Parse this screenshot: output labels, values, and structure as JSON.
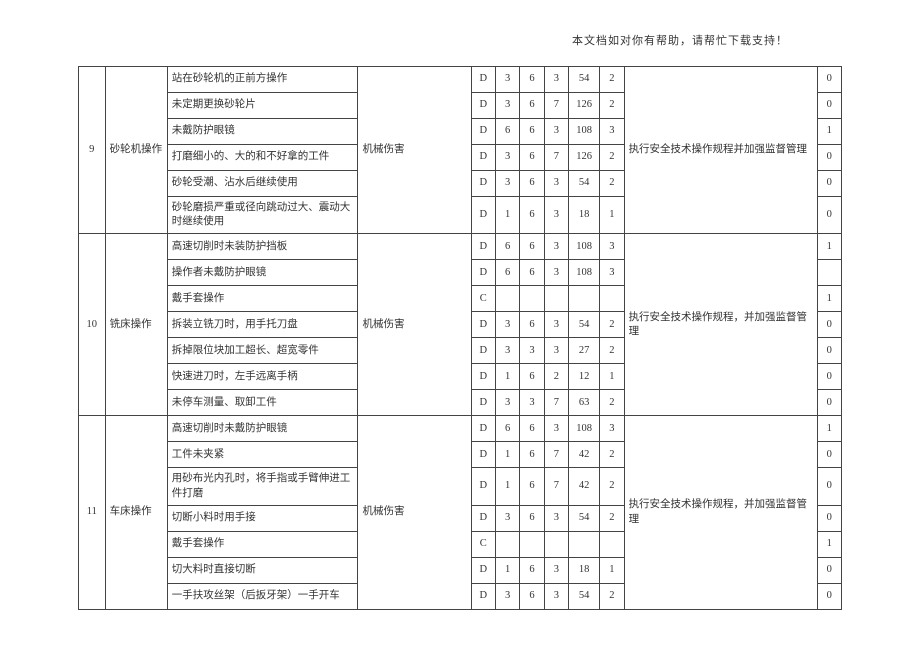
{
  "header_note": "本文档如对你有帮助，请帮忙下载支持！",
  "groups": [
    {
      "idx": "9",
      "op": "砂轮机操作",
      "hazard": "机械伤害",
      "measure": "执行安全技术操作规程并加强监督管理",
      "rows": [
        {
          "desc": "站在砂轮机的正前方操作",
          "d": "D",
          "v1": "3",
          "v2": "6",
          "v3": "3",
          "v4": "54",
          "v5": "2",
          "last": "0"
        },
        {
          "desc": "未定期更换砂轮片",
          "d": "D",
          "v1": "3",
          "v2": "6",
          "v3": "7",
          "v4": "126",
          "v5": "2",
          "last": "0"
        },
        {
          "desc": "未戴防护眼镜",
          "d": "D",
          "v1": "6",
          "v2": "6",
          "v3": "3",
          "v4": "108",
          "v5": "3",
          "last": "1"
        },
        {
          "desc": "打磨细小的、大的和不好拿的工件",
          "d": "D",
          "v1": "3",
          "v2": "6",
          "v3": "7",
          "v4": "126",
          "v5": "2",
          "last": "0"
        },
        {
          "desc": "砂轮受潮、沾水后继续使用",
          "d": "D",
          "v1": "3",
          "v2": "6",
          "v3": "3",
          "v4": "54",
          "v5": "2",
          "last": "0"
        },
        {
          "desc": "砂轮磨损严重或径向跳动过大、震动大时继续使用",
          "d": "D",
          "v1": "1",
          "v2": "6",
          "v3": "3",
          "v4": "18",
          "v5": "1",
          "last": "0"
        }
      ]
    },
    {
      "idx": "10",
      "op": "铣床操作",
      "hazard": "机械伤害",
      "measure": "执行安全技术操作规程，并加强监督管理",
      "rows": [
        {
          "desc": "高速切削时未装防护挡板",
          "d": "D",
          "v1": "6",
          "v2": "6",
          "v3": "3",
          "v4": "108",
          "v5": "3",
          "last": "1"
        },
        {
          "desc": "操作者未戴防护眼镜",
          "d": "D",
          "v1": "6",
          "v2": "6",
          "v3": "3",
          "v4": "108",
          "v5": "3",
          "last": ""
        },
        {
          "desc": "戴手套操作",
          "d": "C",
          "v1": "",
          "v2": "",
          "v3": "",
          "v4": "",
          "v5": "",
          "last": "1"
        },
        {
          "desc": "拆装立铣刀时，用手托刀盘",
          "d": "D",
          "v1": "3",
          "v2": "6",
          "v3": "3",
          "v4": "54",
          "v5": "2",
          "last": "0"
        },
        {
          "desc": "拆掉限位块加工超长、超宽零件",
          "d": "D",
          "v1": "3",
          "v2": "3",
          "v3": "3",
          "v4": "27",
          "v5": "2",
          "last": "0"
        },
        {
          "desc": "快速进刀时，左手远离手柄",
          "d": "D",
          "v1": "1",
          "v2": "6",
          "v3": "2",
          "v4": "12",
          "v5": "1",
          "last": "0"
        },
        {
          "desc": "未停车测量、取卸工件",
          "d": "D",
          "v1": "3",
          "v2": "3",
          "v3": "7",
          "v4": "63",
          "v5": "2",
          "last": "0"
        }
      ]
    },
    {
      "idx": "11",
      "op": "车床操作",
      "hazard": "机械伤害",
      "measure": "执行安全技术操作规程，并加强监督管理",
      "rows": [
        {
          "desc": "高速切削时未戴防护眼镜",
          "d": "D",
          "v1": "6",
          "v2": "6",
          "v3": "3",
          "v4": "108",
          "v5": "3",
          "last": "1"
        },
        {
          "desc": "工件未夹紧",
          "d": "D",
          "v1": "1",
          "v2": "6",
          "v3": "7",
          "v4": "42",
          "v5": "2",
          "last": "0"
        },
        {
          "desc": "用砂布光内孔时，将手指或手臂伸进工件打磨",
          "d": "D",
          "v1": "1",
          "v2": "6",
          "v3": "7",
          "v4": "42",
          "v5": "2",
          "last": "0"
        },
        {
          "desc": "切断小料时用手接",
          "d": "D",
          "v1": "3",
          "v2": "6",
          "v3": "3",
          "v4": "54",
          "v5": "2",
          "last": "0"
        },
        {
          "desc": "戴手套操作",
          "d": "C",
          "v1": "",
          "v2": "",
          "v3": "",
          "v4": "",
          "v5": "",
          "last": "1"
        },
        {
          "desc": "切大料时直接切断",
          "d": "D",
          "v1": "1",
          "v2": "6",
          "v3": "3",
          "v4": "18",
          "v5": "1",
          "last": "0"
        },
        {
          "desc": "一手扶攻丝架（后扳牙架）一手开车",
          "d": "D",
          "v1": "3",
          "v2": "6",
          "v3": "3",
          "v4": "54",
          "v5": "2",
          "last": "0"
        }
      ]
    }
  ]
}
